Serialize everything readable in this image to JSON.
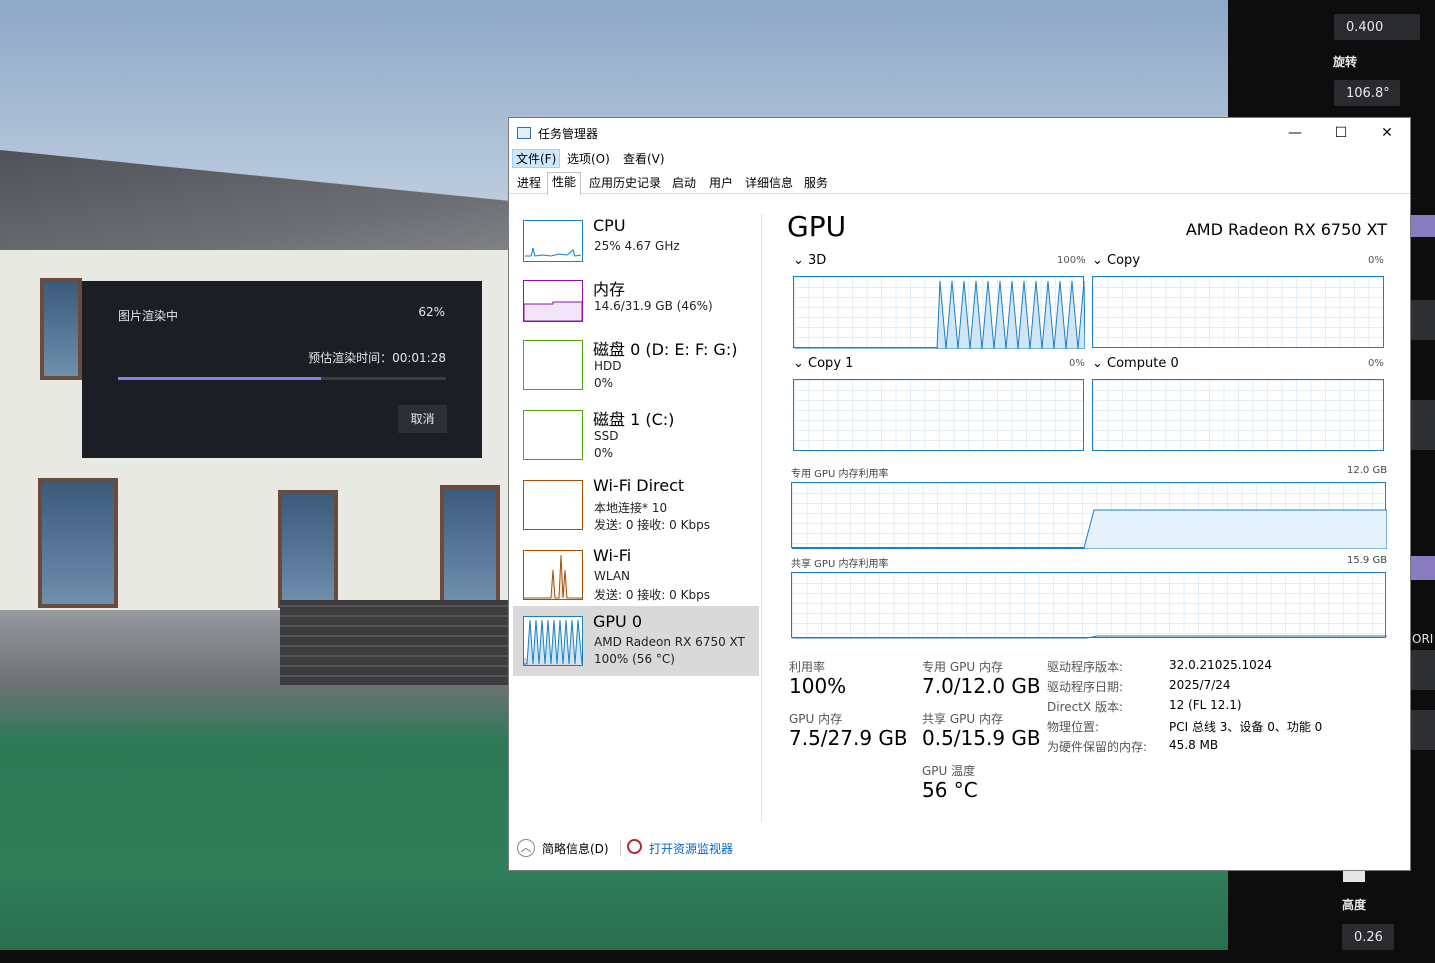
{
  "right_panel": {
    "value1": "0.400",
    "rotate_label": "旋转",
    "rotate_value": "106.8°",
    "height_label": "高度",
    "height_value": "0.26",
    "side_text": "ORI"
  },
  "render_dialog": {
    "title": "图片渲染中",
    "percent": "62%",
    "progress": 0.62,
    "eta": "预估渲染时间：00:01:28",
    "cancel": "取消"
  },
  "task_manager": {
    "title": "任务管理器",
    "window_controls": {
      "minimize": "—",
      "maximize": "☐",
      "close": "✕"
    },
    "menu": [
      "文件(F)",
      "选项(O)",
      "查看(V)"
    ],
    "tabs": [
      "进程",
      "性能",
      "应用历史记录",
      "启动",
      "用户",
      "详细信息",
      "服务"
    ],
    "selected_tab": "性能",
    "sidebar": [
      {
        "name": "CPU",
        "l2": "25%  4.67 GHz",
        "l3": "",
        "color": "#1c7fc0"
      },
      {
        "name": "内存",
        "l2": "14.6/31.9 GB (46%)",
        "l3": "",
        "color": "#8b12ae"
      },
      {
        "name": "磁盘 0 (D: E: F: G:)",
        "l2": "HDD",
        "l3": "0%",
        "color": "#4da60c"
      },
      {
        "name": "磁盘 1 (C:)",
        "l2": "SSD",
        "l3": "0%",
        "color": "#4da60c"
      },
      {
        "name": "Wi-Fi Direct",
        "l2": "本地连接* 10",
        "l3": "发送: 0  接收: 0 Kbps",
        "color": "#a74f01"
      },
      {
        "name": "Wi-Fi",
        "l2": "WLAN",
        "l3": "发送: 0  接收: 0 Kbps",
        "color": "#a74f01"
      },
      {
        "name": "GPU 0",
        "l2": "AMD Radeon RX 6750 XT",
        "l3": "100% (56 °C)",
        "color": "#1c7fc0"
      }
    ],
    "gpu": {
      "header": "GPU",
      "model": "AMD Radeon RX 6750 XT",
      "engines": [
        {
          "label": "3D",
          "pct": "100%"
        },
        {
          "label": "Copy",
          "pct": "0%"
        },
        {
          "label": "Copy 1",
          "pct": "0%"
        },
        {
          "label": "Compute 0",
          "pct": "0%"
        }
      ],
      "dedicated_label": "专用 GPU 内存利用率",
      "dedicated_max": "12.0 GB",
      "shared_label": "共享 GPU 内存利用率",
      "shared_max": "15.9 GB",
      "stats": {
        "util_label": "利用率",
        "util": "100%",
        "ded_label": "专用 GPU 内存",
        "ded": "7.0/12.0 GB",
        "gpumem_label": "GPU 内存",
        "gpumem": "7.5/27.9 GB",
        "shared_label": "共享 GPU 内存",
        "shared": "0.5/15.9 GB",
        "temp_label": "GPU 温度",
        "temp": "56 °C"
      },
      "info": [
        {
          "k": "驱动程序版本:",
          "v": "32.0.21025.1024"
        },
        {
          "k": "驱动程序日期:",
          "v": "2025/7/24"
        },
        {
          "k": "DirectX 版本:",
          "v": "12 (FL 12.1)"
        },
        {
          "k": "物理位置:",
          "v": "PCI 总线 3、设备 0、功能 0"
        },
        {
          "k": "为硬件保留的内存:",
          "v": "45.8 MB"
        }
      ]
    },
    "footer": {
      "less": "简略信息(D)",
      "monitor": "打开资源监视器"
    }
  }
}
